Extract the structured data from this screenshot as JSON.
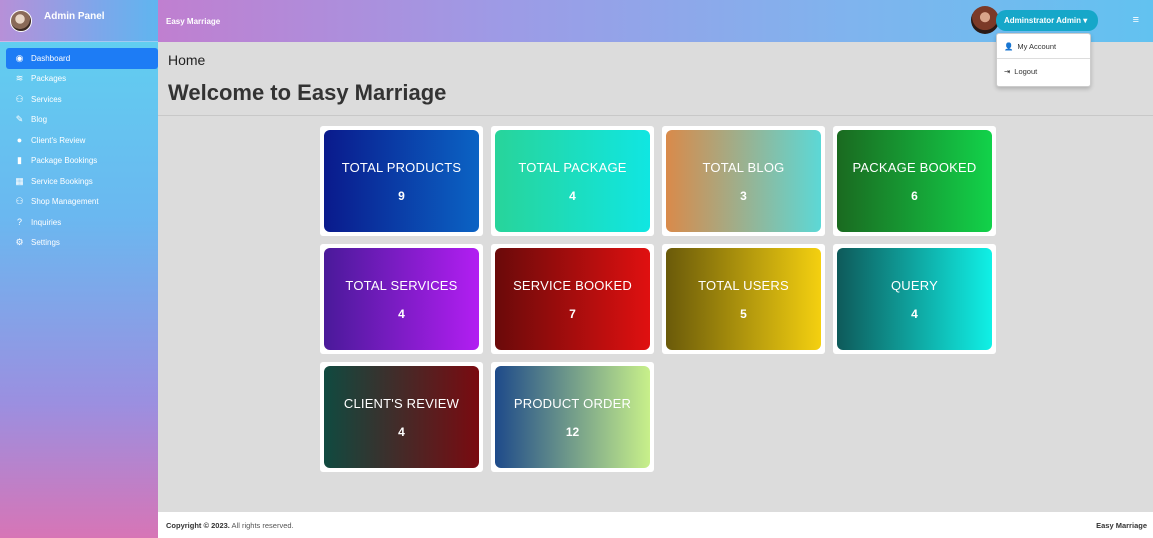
{
  "sidebar": {
    "brand": "Admin Panel",
    "items": [
      {
        "label": "Dashboard",
        "icon": "dashboard-icon",
        "glyph": "◉",
        "active": true
      },
      {
        "label": "Packages",
        "icon": "layers-icon",
        "glyph": "≋"
      },
      {
        "label": "Services",
        "icon": "gift-icon",
        "glyph": "⚇"
      },
      {
        "label": "Blog",
        "icon": "blog-icon",
        "glyph": "✎"
      },
      {
        "label": "Client's Review",
        "icon": "comments-icon",
        "glyph": "●"
      },
      {
        "label": "Package Bookings",
        "icon": "clipboard-icon",
        "glyph": "▮"
      },
      {
        "label": "Service Bookings",
        "icon": "calendar-icon",
        "glyph": "▦"
      },
      {
        "label": "Shop Management",
        "icon": "gift-icon",
        "glyph": "⚇"
      },
      {
        "label": "Inquiries",
        "icon": "question-icon",
        "glyph": "?"
      },
      {
        "label": "Settings",
        "icon": "cogs-icon",
        "glyph": "⚙"
      }
    ]
  },
  "topbar": {
    "title": "Easy Marriage",
    "user_label": "Adminstrator Admin ▾",
    "menu_glyph": "≡"
  },
  "dropdown": {
    "items": [
      {
        "label": "My Account",
        "icon": "user-icon",
        "glyph": "👤"
      },
      {
        "label": "Logout",
        "icon": "logout-icon",
        "glyph": "⇥"
      }
    ]
  },
  "main": {
    "breadcrumb": "Home",
    "welcome": "Welcome to Easy Marriage"
  },
  "cards": [
    {
      "title": "TOTAL PRODUCTS",
      "count": "9",
      "gradient": [
        "#0a1a8c",
        "#0b63c4"
      ]
    },
    {
      "title": "TOTAL PACKAGE",
      "count": "4",
      "gradient": [
        "#28d49a",
        "#10e6e2"
      ]
    },
    {
      "title": "TOTAL BLOG",
      "count": "3",
      "gradient": [
        "#d98a4a",
        "#5cd8d6"
      ]
    },
    {
      "title": "PACKAGE BOOKED",
      "count": "6",
      "gradient": [
        "#1a6a20",
        "#12d24a"
      ]
    },
    {
      "title": "TOTAL SERVICES",
      "count": "4",
      "gradient": [
        "#4a1a9a",
        "#b21ef2"
      ]
    },
    {
      "title": "SERVICE BOOKED",
      "count": "7",
      "gradient": [
        "#6a0a0a",
        "#e01010"
      ]
    },
    {
      "title": "TOTAL USERS",
      "count": "5",
      "gradient": [
        "#6a5a0a",
        "#f4d010"
      ]
    },
    {
      "title": "QUERY",
      "count": "4",
      "gradient": [
        "#0e5a5a",
        "#10f0e6"
      ]
    },
    {
      "title": "CLIENT'S REVIEW",
      "count": "4",
      "gradient": [
        "#104a40",
        "#7a0a10"
      ]
    },
    {
      "title": "PRODUCT ORDER",
      "count": "12",
      "gradient": [
        "#1e4a8a",
        "#c8f08a"
      ]
    }
  ],
  "footer": {
    "copyright_prefix": "Copyright © 2023.",
    "copyright_suffix": " All rights reserved.",
    "brand": "Easy Marriage"
  }
}
